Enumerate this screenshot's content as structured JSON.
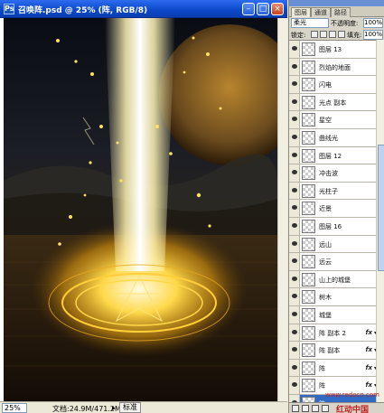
{
  "document": {
    "title": "召唤阵.psd @ 25% (阵, RGB/8)",
    "zoom": "25%",
    "status_doc": "文档:24.9M/471.2M",
    "status_standard": "标准"
  },
  "layers_panel": {
    "tabs": [
      "图层",
      "通道",
      "路径"
    ],
    "blend_mode": "柔光",
    "opacity_label": "不透明度:",
    "opacity_value": "100%",
    "lock_label": "锁定:",
    "fill_label": "填充:",
    "fill_value": "100%",
    "layers": [
      {
        "name": "图层 13",
        "fx": false,
        "selected": false
      },
      {
        "name": "烈焰的地面",
        "fx": false,
        "selected": false
      },
      {
        "name": "闪电",
        "fx": false,
        "selected": false
      },
      {
        "name": "光点 副本",
        "fx": false,
        "selected": false
      },
      {
        "name": "星空",
        "fx": false,
        "selected": false
      },
      {
        "name": "曲线光",
        "fx": false,
        "selected": false
      },
      {
        "name": "图层 12",
        "fx": false,
        "selected": false
      },
      {
        "name": "冲击波",
        "fx": false,
        "selected": false
      },
      {
        "name": "光柱子",
        "fx": false,
        "selected": false
      },
      {
        "name": "近景",
        "fx": false,
        "selected": false
      },
      {
        "name": "图层 16",
        "fx": false,
        "selected": false
      },
      {
        "name": "远山",
        "fx": false,
        "selected": false
      },
      {
        "name": "远云",
        "fx": false,
        "selected": false
      },
      {
        "name": "山上的城堡",
        "fx": false,
        "selected": false
      },
      {
        "name": "树木",
        "fx": false,
        "selected": false
      },
      {
        "name": "城堡",
        "fx": false,
        "selected": false
      },
      {
        "name": "阵 副本 2",
        "fx": true,
        "selected": false
      },
      {
        "name": "阵 副本",
        "fx": true,
        "selected": false
      },
      {
        "name": "阵",
        "fx": true,
        "selected": false
      },
      {
        "name": "阵",
        "fx": true,
        "selected": false
      },
      {
        "name": "阵",
        "fx": false,
        "selected": true
      }
    ],
    "fx_label": "fx"
  },
  "watermark": {
    "url": "www.redocn.com",
    "text": "红动中国"
  },
  "colors": {
    "titlebar": "#0b47c8",
    "selection": "#316ac5",
    "glow": "#ffd84a"
  }
}
